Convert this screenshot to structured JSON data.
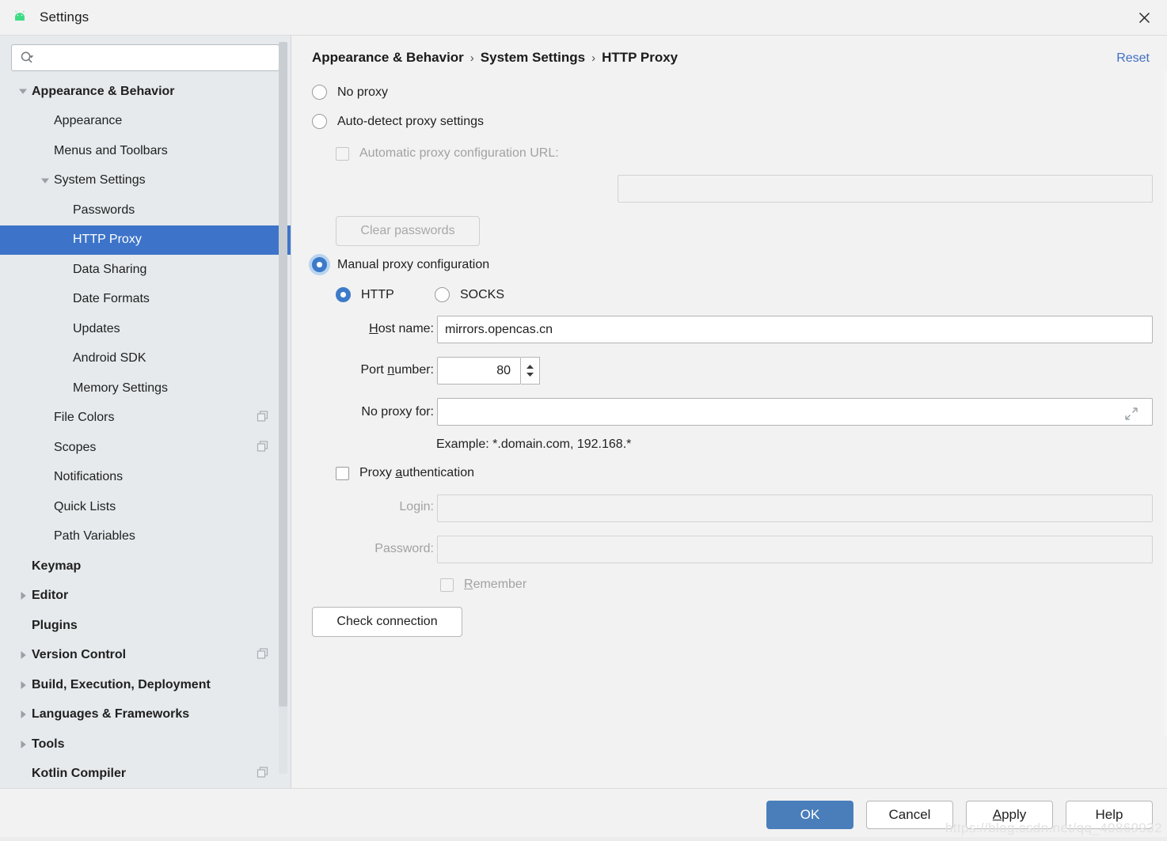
{
  "window": {
    "title": "Settings",
    "app_icon": "android-icon",
    "close_icon": "close-icon",
    "accent_color": "#3d74ca",
    "primary_button_color": "#4a7ebb",
    "link_color": "#3f6fc4"
  },
  "search": {
    "value": "",
    "placeholder": "",
    "icon": "search-icon",
    "dropdown_icon": "chevron-down-icon"
  },
  "sidebar": {
    "items": [
      {
        "label": "Appearance & Behavior",
        "level": 0,
        "bold": true,
        "twisty": "expanded",
        "selected": false,
        "copy_icon": false
      },
      {
        "label": "Appearance",
        "level": 1,
        "bold": false,
        "twisty": "none",
        "selected": false,
        "copy_icon": false
      },
      {
        "label": "Menus and Toolbars",
        "level": 1,
        "bold": false,
        "twisty": "none",
        "selected": false,
        "copy_icon": false
      },
      {
        "label": "System Settings",
        "level": 1,
        "bold": false,
        "twisty": "expanded",
        "selected": false,
        "copy_icon": false
      },
      {
        "label": "Passwords",
        "level": 2,
        "bold": false,
        "twisty": "none",
        "selected": false,
        "copy_icon": false
      },
      {
        "label": "HTTP Proxy",
        "level": 2,
        "bold": false,
        "twisty": "none",
        "selected": true,
        "copy_icon": false
      },
      {
        "label": "Data Sharing",
        "level": 2,
        "bold": false,
        "twisty": "none",
        "selected": false,
        "copy_icon": false
      },
      {
        "label": "Date Formats",
        "level": 2,
        "bold": false,
        "twisty": "none",
        "selected": false,
        "copy_icon": false
      },
      {
        "label": "Updates",
        "level": 2,
        "bold": false,
        "twisty": "none",
        "selected": false,
        "copy_icon": false
      },
      {
        "label": "Android SDK",
        "level": 2,
        "bold": false,
        "twisty": "none",
        "selected": false,
        "copy_icon": false
      },
      {
        "label": "Memory Settings",
        "level": 2,
        "bold": false,
        "twisty": "none",
        "selected": false,
        "copy_icon": false
      },
      {
        "label": "File Colors",
        "level": 1,
        "bold": false,
        "twisty": "none",
        "selected": false,
        "copy_icon": true
      },
      {
        "label": "Scopes",
        "level": 1,
        "bold": false,
        "twisty": "none",
        "selected": false,
        "copy_icon": true
      },
      {
        "label": "Notifications",
        "level": 1,
        "bold": false,
        "twisty": "none",
        "selected": false,
        "copy_icon": false
      },
      {
        "label": "Quick Lists",
        "level": 1,
        "bold": false,
        "twisty": "none",
        "selected": false,
        "copy_icon": false
      },
      {
        "label": "Path Variables",
        "level": 1,
        "bold": false,
        "twisty": "none",
        "selected": false,
        "copy_icon": false
      },
      {
        "label": "Keymap",
        "level": 0,
        "bold": true,
        "twisty": "none",
        "selected": false,
        "copy_icon": false
      },
      {
        "label": "Editor",
        "level": 0,
        "bold": true,
        "twisty": "collapsed",
        "selected": false,
        "copy_icon": false
      },
      {
        "label": "Plugins",
        "level": 0,
        "bold": true,
        "twisty": "none",
        "selected": false,
        "copy_icon": false
      },
      {
        "label": "Version Control",
        "level": 0,
        "bold": true,
        "twisty": "collapsed",
        "selected": false,
        "copy_icon": true
      },
      {
        "label": "Build, Execution, Deployment",
        "level": 0,
        "bold": true,
        "twisty": "collapsed",
        "selected": false,
        "copy_icon": false
      },
      {
        "label": "Languages & Frameworks",
        "level": 0,
        "bold": true,
        "twisty": "collapsed",
        "selected": false,
        "copy_icon": false
      },
      {
        "label": "Tools",
        "level": 0,
        "bold": true,
        "twisty": "collapsed",
        "selected": false,
        "copy_icon": false
      },
      {
        "label": "Kotlin Compiler",
        "level": 0,
        "bold": true,
        "twisty": "none",
        "selected": false,
        "copy_icon": true
      }
    ]
  },
  "breadcrumb": {
    "part1": "Appearance & Behavior",
    "sep1": "›",
    "part2": "System Settings",
    "sep2": "›",
    "part3": "HTTP Proxy"
  },
  "reset": {
    "label": "Reset"
  },
  "proxy": {
    "no_proxy": {
      "label": "No proxy",
      "selected": false
    },
    "auto_detect": {
      "label": "Auto-detect proxy settings",
      "selected": false
    },
    "pac_url": {
      "label": "Automatic proxy configuration URL:",
      "checked": false,
      "enabled": false,
      "value": ""
    },
    "clear_passwords": {
      "label": "Clear passwords",
      "enabled": false
    },
    "manual": {
      "label": "Manual proxy configuration",
      "selected": true,
      "focused": true
    },
    "http": {
      "label": "HTTP",
      "selected": true
    },
    "socks": {
      "label": "SOCKS",
      "selected": false
    },
    "host": {
      "label": "Host name:",
      "mnemonic": "H",
      "value": "mirrors.opencas.cn"
    },
    "port": {
      "label": "Port number:",
      "mnemonic": "n",
      "value": "80"
    },
    "no_proxy_for": {
      "label": "No proxy for:",
      "value": "",
      "expand_icon": "expand-arrows-icon"
    },
    "example_hint": "Example: *.domain.com, 192.168.*",
    "authentication": {
      "label": "Proxy authentication",
      "mnemonic": "a",
      "checked": false
    },
    "login": {
      "label": "Login:",
      "value": "",
      "enabled": false
    },
    "password": {
      "label": "Password:",
      "value": "",
      "enabled": false
    },
    "remember": {
      "label": "Remember",
      "mnemonic": "R",
      "checked": false,
      "enabled": false
    },
    "check_connection": {
      "label": "Check connection"
    }
  },
  "footer": {
    "ok": "OK",
    "cancel": "Cancel",
    "apply": "Apply",
    "help": "Help",
    "watermark": "https://blog.csdn.net/qq_40869932"
  }
}
